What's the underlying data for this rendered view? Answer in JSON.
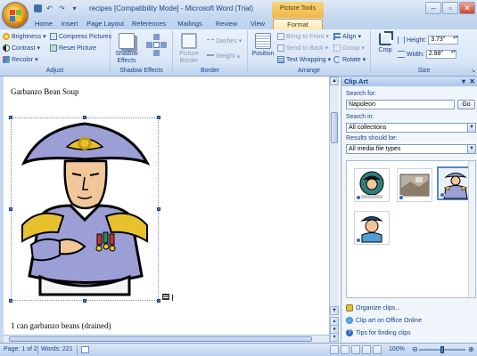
{
  "window": {
    "title": "recipes [Compatibility Mode] - Microsoft Word (Trial)",
    "contextual_tab_group": "Picture Tools"
  },
  "tabs": [
    "Home",
    "Insert",
    "Page Layout",
    "References",
    "Mailings",
    "Review",
    "View",
    "Format"
  ],
  "active_tab": "Format",
  "ribbon": {
    "adjust": {
      "label": "Adjust",
      "brightness": "Brightness",
      "contrast": "Contrast",
      "recolor": "Recolor",
      "compress": "Compress Pictures",
      "reset": "Reset Picture"
    },
    "shadow_effects": {
      "label": "Shadow Effects",
      "shadow_btn": "Shadow Effects"
    },
    "border": {
      "label": "Border",
      "picture_border": "Picture Border",
      "dashes": "Dashes",
      "weight": "Weight"
    },
    "arrange": {
      "label": "Arrange",
      "position": "Position",
      "bring_to_front": "Bring to Front",
      "send_to_back": "Send to Back",
      "text_wrapping": "Text Wrapping",
      "align": "Align",
      "group": "Group",
      "rotate": "Rotate"
    },
    "size": {
      "label": "Size",
      "crop": "Crop",
      "height_label": "Height:",
      "height_value": "3.73\"",
      "width_label": "Width:",
      "width_value": "2.98\""
    }
  },
  "document": {
    "heading": "Garbanzo Bean Soup",
    "line1": "1 can garbanzo beans (drained)"
  },
  "clip_art_pane": {
    "title": "Clip Art",
    "search_for_label": "Search for:",
    "search_value": "Napoleon",
    "go_label": "Go",
    "search_in_label": "Search in:",
    "search_in_value": "All collections",
    "results_label": "Results should be:",
    "results_value": "All media file types",
    "links": [
      "Organize clips...",
      "Clip art on Office Online",
      "Tips for finding clips"
    ]
  },
  "status_bar": {
    "page": "Page: 1 of 2",
    "words": "Words: 221",
    "zoom": "100%"
  },
  "colors": {
    "accent": "#15428b",
    "ribbon_bg": "#d9e6f6",
    "contextual_tab": "#f0b54a",
    "uniform": "#9c9ed6"
  }
}
